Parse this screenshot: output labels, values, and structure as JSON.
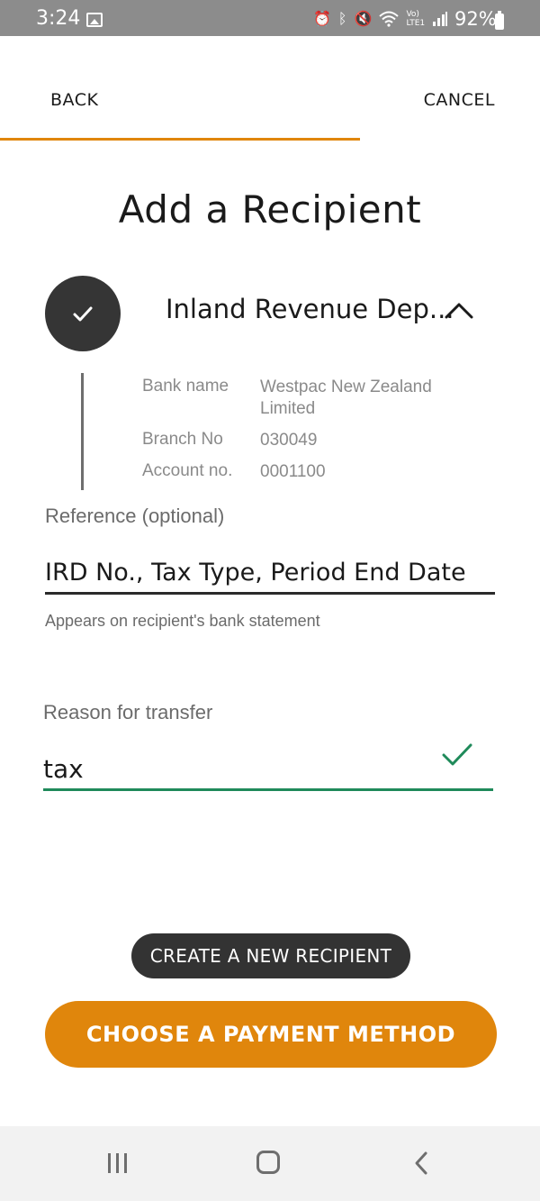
{
  "status_bar": {
    "time": "3:24",
    "battery_percent": "92%",
    "icons": [
      "gallery-icon",
      "alarm-icon",
      "bluetooth-icon",
      "mute-icon",
      "wifi-icon",
      "volte-icon",
      "signal-icon",
      "battery-icon"
    ]
  },
  "header": {
    "back_label": "BACK",
    "cancel_label": "CANCEL",
    "progress_fraction": 0.667,
    "accent_color": "#e0860c"
  },
  "page": {
    "title": "Add a Recipient"
  },
  "recipient": {
    "name": "Inland Revenue Dep...",
    "details": [
      {
        "label": "Bank name",
        "value": "Westpac New Zealand Limited"
      },
      {
        "label": "Branch No",
        "value": "030049"
      },
      {
        "label": "Account no.",
        "value": "0001100"
      }
    ]
  },
  "reference": {
    "label": "Reference (optional)",
    "value": "IRD No., Tax Type, Period End Date",
    "helper": "Appears on recipient's bank statement"
  },
  "reason": {
    "label": "Reason for transfer",
    "value": "tax",
    "valid_color": "#1f8a5a"
  },
  "buttons": {
    "create_recipient": "CREATE A NEW RECIPIENT",
    "choose_payment": "CHOOSE A PAYMENT METHOD"
  }
}
